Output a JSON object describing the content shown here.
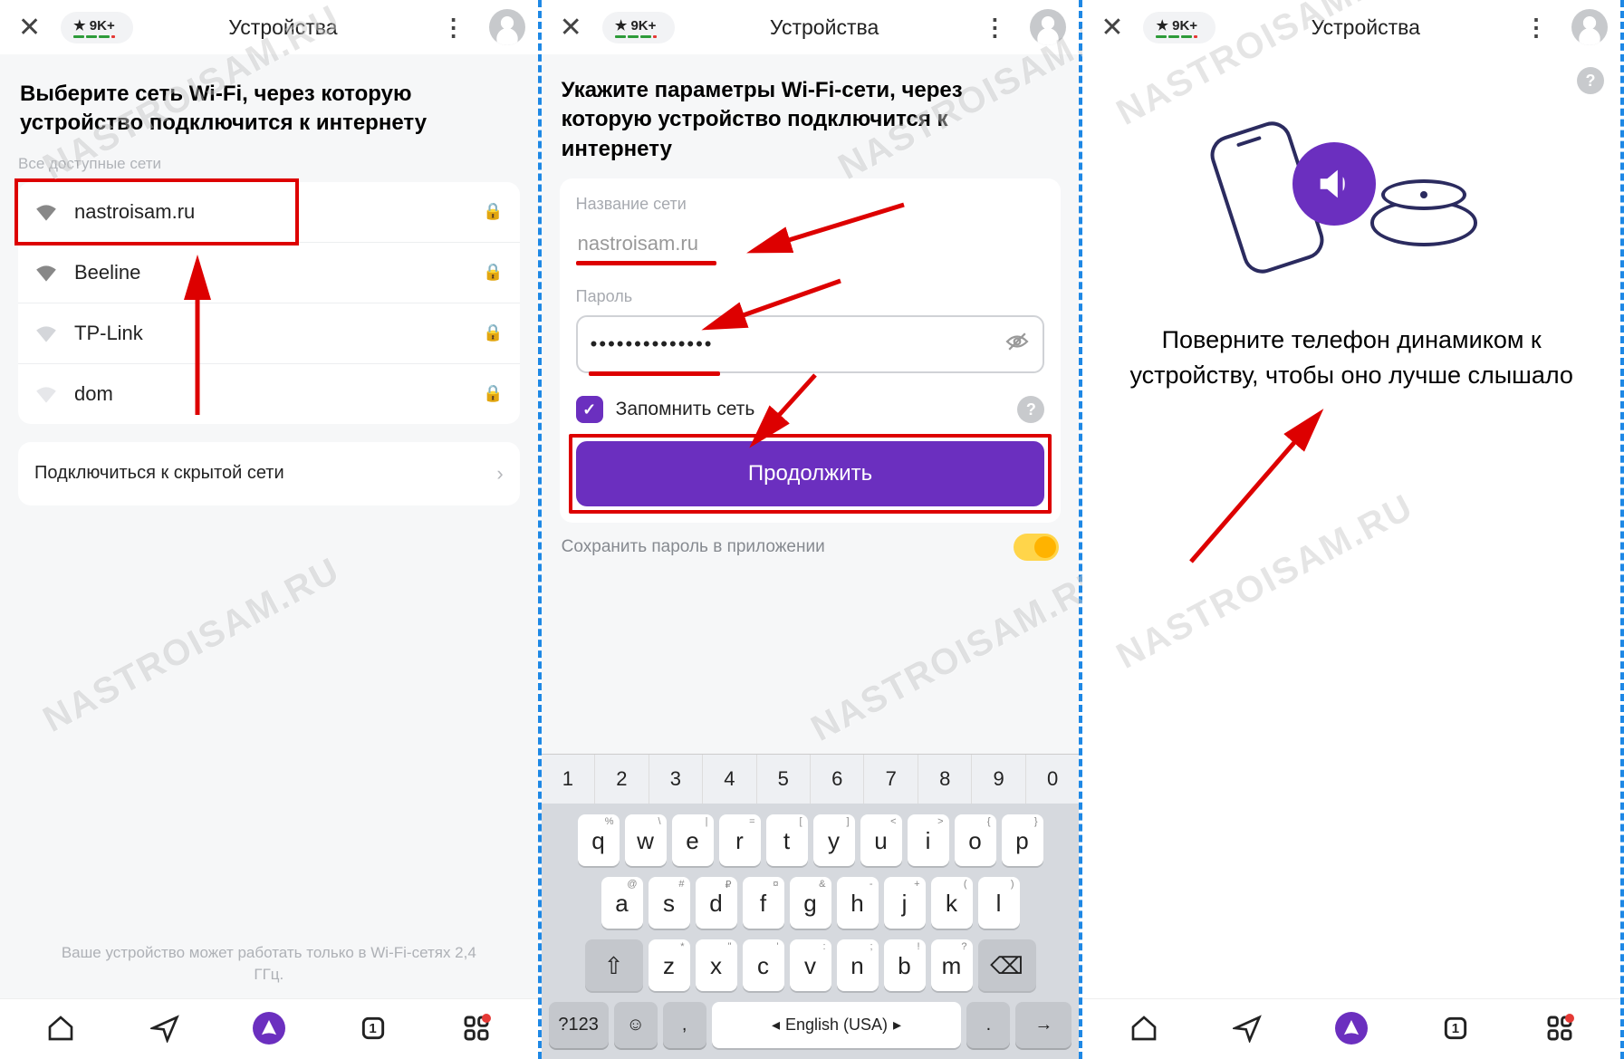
{
  "watermark": "NASTROISAM.RU",
  "badge": {
    "rating": "9K+"
  },
  "tab_title": "Устройства",
  "screen1": {
    "heading": "Выберите сеть Wi-Fi, через которую устройство подключится к интернету",
    "subheading": "Все доступные сети",
    "networks": [
      {
        "name": "nastroisam.ru",
        "locked": true,
        "strength": "strong",
        "highlighted": true
      },
      {
        "name": "Beeline",
        "locked": true,
        "strength": "strong"
      },
      {
        "name": "TP-Link",
        "locked": true,
        "strength": "weak"
      },
      {
        "name": "dom",
        "locked": true,
        "strength": "weak"
      }
    ],
    "hidden_row": "Подключиться к скрытой сети",
    "footer": "Ваше устройство может работать только в Wi-Fi-сетях 2,4 ГГц."
  },
  "screen2": {
    "heading": "Укажите параметры Wi-Fi-сети, через которую устройство подключится к интернету",
    "label_ssid": "Название сети",
    "value_ssid": "nastroisam.ru",
    "label_pwd": "Пароль",
    "value_pwd_mask": "••••••••••••••",
    "remember": "Запомнить сеть",
    "continue": "Продолжить",
    "save_pwd": "Сохранить пароль в приложении",
    "keyboard": {
      "numbers": [
        "1",
        "2",
        "3",
        "4",
        "5",
        "6",
        "7",
        "8",
        "9",
        "0"
      ],
      "row1": [
        {
          "k": "q",
          "a": "%"
        },
        {
          "k": "w",
          "a": "\\"
        },
        {
          "k": "e",
          "a": "|"
        },
        {
          "k": "r",
          "a": "="
        },
        {
          "k": "t",
          "a": "["
        },
        {
          "k": "y",
          "a": "]"
        },
        {
          "k": "u",
          "a": "<"
        },
        {
          "k": "i",
          "a": ">"
        },
        {
          "k": "o",
          "a": "{"
        },
        {
          "k": "p",
          "a": "}"
        }
      ],
      "row2": [
        {
          "k": "a",
          "a": "@"
        },
        {
          "k": "s",
          "a": "#"
        },
        {
          "k": "d",
          "a": "₽"
        },
        {
          "k": "f",
          "a": "¤"
        },
        {
          "k": "g",
          "a": "&"
        },
        {
          "k": "h",
          "a": "-"
        },
        {
          "k": "j",
          "a": "+"
        },
        {
          "k": "k",
          "a": "("
        },
        {
          "k": "l",
          "a": ")"
        }
      ],
      "row3": [
        {
          "k": "z",
          "a": "*"
        },
        {
          "k": "x",
          "a": "\""
        },
        {
          "k": "c",
          "a": "'"
        },
        {
          "k": "v",
          "a": ":"
        },
        {
          "k": "n",
          "a": ";"
        },
        {
          "k": "b",
          "a": "!"
        },
        {
          "k": "m",
          "a": "?"
        }
      ],
      "sym": "?123",
      "lang": "English (USA)",
      "dot": "."
    }
  },
  "screen3": {
    "message": "Поверните телефон динамиком к устройству, чтобы оно лучше слышало"
  },
  "nav": {
    "tab_count": "1"
  }
}
